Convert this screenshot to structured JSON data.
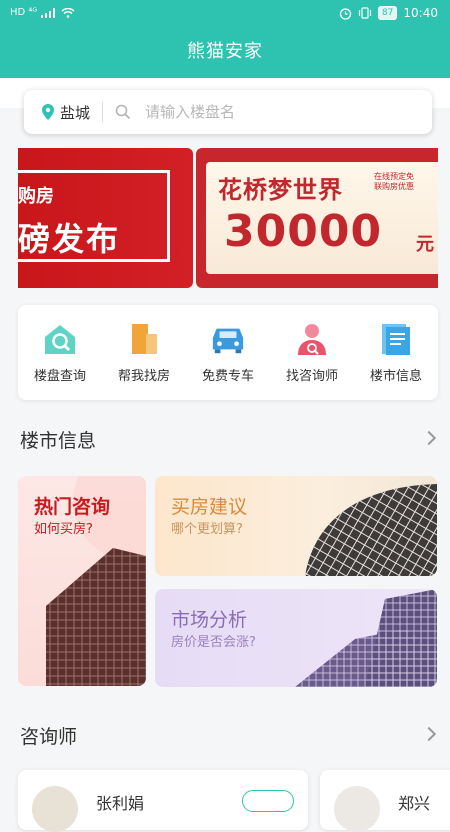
{
  "status_bar": {
    "network": "HD ⁴ᴳ",
    "battery": "87",
    "time": "10:40"
  },
  "app": {
    "title": "熊猫安家"
  },
  "search": {
    "city": "盐城",
    "placeholder": "请输入楼盘名"
  },
  "banner": {
    "left_line1": "购房",
    "left_line2": "磅发布",
    "right_title": "花桥梦世界",
    "right_note_line1": "在线预定免",
    "right_note_line2": "联购房优惠",
    "right_amount": "30000",
    "right_unit": "元"
  },
  "quick_nav": [
    {
      "label": "楼盘查询",
      "icon": "house-search-icon"
    },
    {
      "label": "帮我找房",
      "icon": "building-icon"
    },
    {
      "label": "免费专车",
      "icon": "car-icon"
    },
    {
      "label": "找咨询师",
      "icon": "consultant-icon"
    },
    {
      "label": "楼市信息",
      "icon": "document-icon"
    }
  ],
  "market_section": {
    "title": "楼市信息",
    "cards": {
      "hot": {
        "title": "热门咨询",
        "subtitle": "如何买房?"
      },
      "buy": {
        "title": "买房建议",
        "subtitle": "哪个更划算?"
      },
      "market": {
        "title": "市场分析",
        "subtitle": "房价是否会涨?"
      }
    }
  },
  "consultant_section": {
    "title": "咨询师",
    "items": [
      {
        "name": "张利娟"
      },
      {
        "name": "郑兴"
      }
    ]
  },
  "colors": {
    "brand": "#2ec3b0",
    "banner_red": "#c8161b"
  }
}
